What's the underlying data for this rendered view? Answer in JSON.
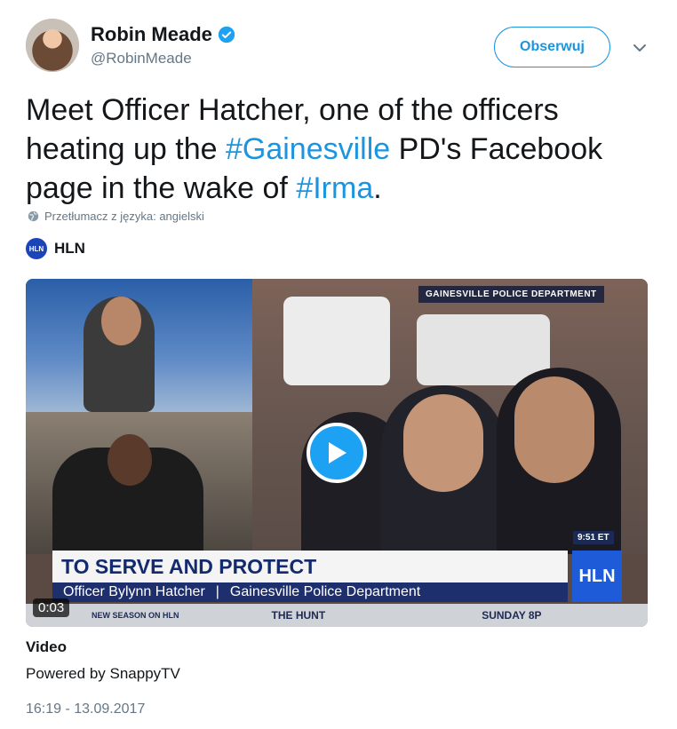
{
  "author": {
    "name": "Robin Meade",
    "handle": "@RobinMeade",
    "verified": true
  },
  "follow_button": {
    "label": "Obserwuj"
  },
  "tweet": {
    "parts": [
      {
        "text": "Meet Officer Hatcher, one of the officers heating up the ",
        "hashtag": false
      },
      {
        "text": "#Gainesville",
        "hashtag": true
      },
      {
        "text": " PD's Facebook page in the wake of ",
        "hashtag": false
      },
      {
        "text": "#Irma",
        "hashtag": true
      },
      {
        "text": ".",
        "hashtag": false
      }
    ]
  },
  "translate_label": "Przetłumacz z języka: angielski",
  "source": {
    "badge": "HLN",
    "name": "HLN"
  },
  "video": {
    "duration": "0:03",
    "overlay_label": "GAINESVILLE POLICE DEPARTMENT",
    "time_tag": "9:51 ET",
    "lower_third_title": "TO SERVE AND PROTECT",
    "lower_third_name": "Officer Bylynn Hatcher",
    "lower_third_org": "Gainesville Police Department",
    "network_logo": "HLN",
    "ticker_left": "NEW SEASON ON HLN",
    "ticker_mid": "THE HUNT",
    "ticker_right": "SUNDAY 8P",
    "title": "Video",
    "powered_by": "Powered by SnappyTV"
  },
  "timestamp": "16:19 - 13.09.2017",
  "colors": {
    "link": "#1b95e0",
    "muted": "#657786",
    "play": "#1da1f2"
  }
}
